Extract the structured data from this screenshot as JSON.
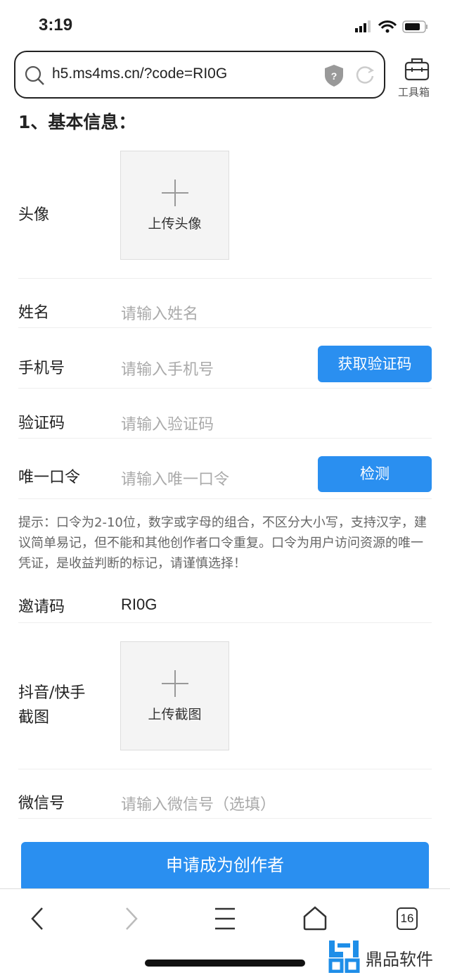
{
  "status": {
    "time": "3:19"
  },
  "browser": {
    "url": "h5.ms4ms.cn/?code=RI0G",
    "toolbox_label": "工具箱",
    "tab_count": "16"
  },
  "form": {
    "section_title": "1、基本信息：",
    "avatar_label": "头像",
    "avatar_upload": "上传头像",
    "name_label": "姓名",
    "name_placeholder": "请输入姓名",
    "phone_label": "手机号",
    "phone_placeholder": "请输入手机号",
    "get_code_button": "获取验证码",
    "code_label": "验证码",
    "code_placeholder": "请输入验证码",
    "token_label": "唯一口令",
    "token_placeholder": "请输入唯一口令",
    "check_button": "检测",
    "hint": "提示：口令为2-10位，数字或字母的组合，不区分大小写，支持汉字，建议简单易记，但不能和其他创作者口令重复。口令为用户访问资源的唯一凭证，是收益判断的标记，请谨慎选择！",
    "invite_label": "邀请码",
    "invite_value": "RI0G",
    "screenshot_label_1": "抖音/快手",
    "screenshot_label_2": "截图",
    "screenshot_upload": "上传截图",
    "wechat_label": "微信号",
    "wechat_placeholder": "请输入微信号（选填）",
    "submit_button": "申请成为创作者"
  },
  "watermark": "鼎品软件",
  "colors": {
    "accent": "#2a8ff0"
  }
}
